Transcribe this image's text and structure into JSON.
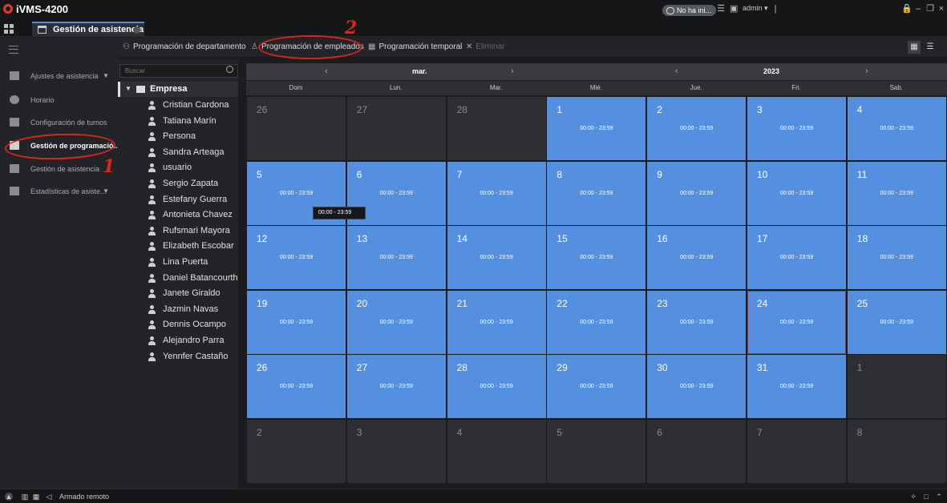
{
  "app": {
    "title": "iVMS-4200"
  },
  "tabs": [
    {
      "label": "Gestión de asistencia"
    }
  ],
  "top_right": {
    "pill": "No ha ini...",
    "user": "admin"
  },
  "sidebar": {
    "items": [
      {
        "label": "Ajustes de asistencia",
        "has_arrow": true
      },
      {
        "label": "Horario"
      },
      {
        "label": "Configuración de turnos"
      },
      {
        "label": "Gestión de programació..."
      },
      {
        "label": "Gestión de asistencia"
      },
      {
        "label": "Estadísticas de asiste...",
        "has_arrow": true
      }
    ],
    "active_index": 3
  },
  "subnav": {
    "dept": "Programación de departamento",
    "emp": "Programación de empleados",
    "temp": "Programación temporal",
    "delete": "Eliminar"
  },
  "tree": {
    "search_placeholder": "Buscar",
    "root": "Empresa",
    "people": [
      "Cristian Cardona",
      "Tatiana Marín",
      "Persona",
      "Sandra Arteaga",
      "usuario",
      "Sergio Zapata",
      "Estefany Guerra",
      "Antonieta Chavez",
      "Rufsmari Mayora",
      "Elizabeth Escobar",
      "Lina Puerta",
      "Daniel Batancourth",
      "Janete Giraldo",
      "Jazmin Navas",
      "Dennis Ocampo",
      "Alejandro Parra",
      "Yennfer Castaño"
    ]
  },
  "calendar": {
    "month": "mar.",
    "year": "2023",
    "weekdays": [
      "Dom",
      "Lun.",
      "Mar.",
      "Mié.",
      "Jue.",
      "Fri.",
      "Sab."
    ],
    "time_range": "00:00 - 23:59",
    "tooltip": "00:00 - 23:59",
    "weeks": [
      [
        {
          "d": "26",
          "on": false
        },
        {
          "d": "27",
          "on": false
        },
        {
          "d": "28",
          "on": false
        },
        {
          "d": "1",
          "on": true
        },
        {
          "d": "2",
          "on": true
        },
        {
          "d": "3",
          "on": true
        },
        {
          "d": "4",
          "on": true
        }
      ],
      [
        {
          "d": "5",
          "on": true
        },
        {
          "d": "6",
          "on": true
        },
        {
          "d": "7",
          "on": true
        },
        {
          "d": "8",
          "on": true
        },
        {
          "d": "9",
          "on": true
        },
        {
          "d": "10",
          "on": true
        },
        {
          "d": "11",
          "on": true
        }
      ],
      [
        {
          "d": "12",
          "on": true
        },
        {
          "d": "13",
          "on": true
        },
        {
          "d": "14",
          "on": true
        },
        {
          "d": "15",
          "on": true
        },
        {
          "d": "16",
          "on": true
        },
        {
          "d": "17",
          "on": true
        },
        {
          "d": "18",
          "on": true
        }
      ],
      [
        {
          "d": "19",
          "on": true
        },
        {
          "d": "20",
          "on": true
        },
        {
          "d": "21",
          "on": true
        },
        {
          "d": "22",
          "on": true
        },
        {
          "d": "23",
          "on": true
        },
        {
          "d": "24",
          "on": true,
          "hl": true
        },
        {
          "d": "25",
          "on": true
        }
      ],
      [
        {
          "d": "26",
          "on": true
        },
        {
          "d": "27",
          "on": true
        },
        {
          "d": "28",
          "on": true
        },
        {
          "d": "29",
          "on": true
        },
        {
          "d": "30",
          "on": true
        },
        {
          "d": "31",
          "on": true
        },
        {
          "d": "1",
          "on": false
        }
      ],
      [
        {
          "d": "2",
          "on": false
        },
        {
          "d": "3",
          "on": false
        },
        {
          "d": "4",
          "on": false
        },
        {
          "d": "5",
          "on": false
        },
        {
          "d": "6",
          "on": false
        },
        {
          "d": "7",
          "on": false
        },
        {
          "d": "8",
          "on": false
        }
      ]
    ]
  },
  "annotations": {
    "one": "1",
    "two": "2"
  },
  "statusbar": {
    "text": "Armado remoto"
  },
  "colors": {
    "schedule_blue": "#5590e0",
    "annotation_red": "#e2231a",
    "highlight_border": "#b03030"
  }
}
